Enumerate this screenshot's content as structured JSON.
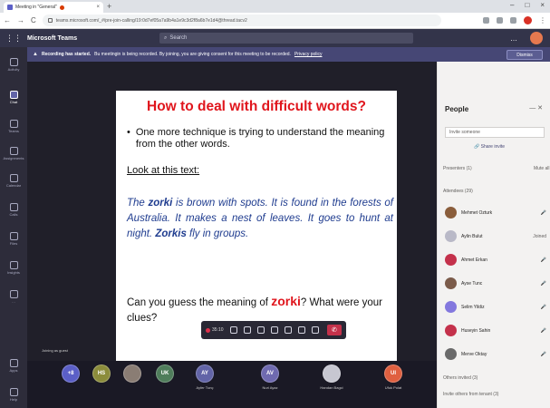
{
  "browser": {
    "tab_title": "Meeting in \"General\"",
    "new_tab": "+",
    "window_controls": [
      "–",
      "□",
      "×"
    ],
    "nav_buttons": [
      "←",
      "→",
      "C"
    ],
    "url": "teams.microsoft.com/_#/pre-join-calling/19:0d7ef05a7a9b4a1e9c3d2f8a6b7e1d4@thread.tacv2"
  },
  "teams": {
    "app_name": "Microsoft Teams",
    "search_placeholder": "Search",
    "more": "…"
  },
  "rail": [
    {
      "label": "Activity",
      "active": false
    },
    {
      "label": "Chat",
      "active": true
    },
    {
      "label": "Teams",
      "active": false
    },
    {
      "label": "Assignments",
      "active": false
    },
    {
      "label": "Calendar",
      "active": false
    },
    {
      "label": "Calls",
      "active": false
    },
    {
      "label": "Files",
      "active": false
    },
    {
      "label": "Insights",
      "active": false
    },
    {
      "label": "…",
      "active": false
    },
    {
      "label": "Apps",
      "active": false
    },
    {
      "label": "Help",
      "active": false
    }
  ],
  "banner": {
    "title": "Recording has started.",
    "text": "Bu meetingin is being recorded. By joining, you are giving consent for this meeting to be recorded.",
    "link": "Privacy policy",
    "dismiss": "Dismiss"
  },
  "slide": {
    "title": "How to deal with difficult words?",
    "bullet": "One more technique is trying to understand the meaning from the other words.",
    "look_at": "Look at this text:",
    "para_1": "The ",
    "kw_1": "zorki",
    "para_2": " is brown with spots. It is found in the forests of Australia. It makes a nest of leaves. It goes to hunt at night. ",
    "kw_2": "Zorkis",
    "para_3": " fly in groups.",
    "question_1": "Can you guess the meaning of ",
    "question_kw": "zorki",
    "question_2": "? What were your clues?"
  },
  "controls": {
    "timer": "35:10",
    "hang_up": "✆"
  },
  "presenter_label": "Joining as guest",
  "participants": [
    {
      "initials": "+8",
      "name": "",
      "color": "#5b5fc7"
    },
    {
      "initials": "HS",
      "name": "",
      "color": "#8b8c3b"
    },
    {
      "initials": "",
      "name": "",
      "color": "#8a7d74"
    },
    {
      "initials": "UK",
      "name": "",
      "color": "#4f7d5b"
    },
    {
      "initials": "AY",
      "name": "Ayfer Tunç",
      "color": "#6264a7"
    },
    {
      "initials": "AV",
      "name": "Nuri Ayaz",
      "color": "#6f6ab0"
    },
    {
      "initials": "",
      "name": "Handan Bagci",
      "color": "#c7c7d1"
    },
    {
      "initials": "UI",
      "name": "Ufuk Polat",
      "color": "#e06040"
    }
  ],
  "people_panel": {
    "title": "People",
    "invite_placeholder": "Invite someone",
    "share_invite": "Share invite",
    "presenters": "Presenters (1)",
    "presenters_right": "Mute all",
    "attendees": "Attendees (29)",
    "attendees_list": [
      {
        "name": "Mehmet Ozturk",
        "status": "🎤",
        "color": "#8a5d3b"
      },
      {
        "name": "Aylin Bulut",
        "status": "Joined",
        "color": "#b9b9c7"
      },
      {
        "name": "Ahmet Erkan",
        "status": "🎤",
        "color": "#c4314b"
      },
      {
        "name": "Ayse Tunc",
        "status": "🎤",
        "color": "#7b5b4a"
      },
      {
        "name": "Selim Yildiz",
        "status": "🎤",
        "color": "#8378de"
      },
      {
        "name": "Huseyin Sahin",
        "status": "🎤",
        "color": "#c4314b"
      },
      {
        "name": "Merve Oktay",
        "status": "🎤",
        "color": "#6a6a6a"
      }
    ],
    "others_invited": "Others invited (3)",
    "invite_others": "Invite others from tenant (3)"
  }
}
